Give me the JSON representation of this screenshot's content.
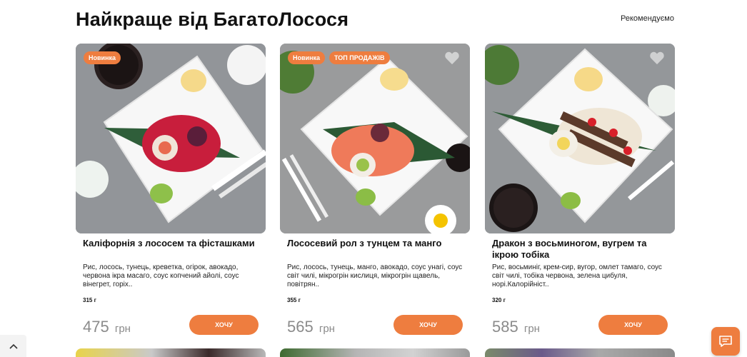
{
  "section": {
    "title": "Найкраще від БагатоЛосося",
    "sort_label": "Рекомендуємо"
  },
  "products": [
    {
      "badges": [
        "Новинка"
      ],
      "name": "Каліфорнія з лососем та фісташками",
      "description": "Рис, лосось, тунець, креветка, огірок, авокадо, червона ікра масаго, соус копчений айолі, соус вінегрет, горіх..",
      "weight": "315 г",
      "price": "475",
      "currency": "грн",
      "button": "ХОЧУ"
    },
    {
      "badges": [
        "Новинка",
        "ТОП ПРОДАЖІВ"
      ],
      "name": "Лососевий рол з тунцем та манго",
      "description": "Рис, лосось, тунець, манго, авокадо, соус унагі, соус світ чилі, мікрогрін кислиця, мікрогрін щавель, повітрян..",
      "weight": "355 г",
      "price": "565",
      "currency": "грн",
      "button": "ХОЧУ"
    },
    {
      "badges": [],
      "name": "Дракон з восьминогом, вугрем та ікрою тобіка",
      "description": "Рис, восьминіг, крем-сир, вугор, омлет тамаго, соус світ чилі, тобіка червона, зелена цибуля, норі.Калорійніст..",
      "weight": "320 г",
      "price": "585",
      "currency": "грн",
      "button": "ХОЧУ"
    }
  ],
  "icons": {
    "heart": "heart-icon",
    "scroll_top": "chevron-up-icon",
    "chat": "chat-icon"
  },
  "colors": {
    "accent": "#ee7d3f",
    "price": "#8b8b8b"
  }
}
